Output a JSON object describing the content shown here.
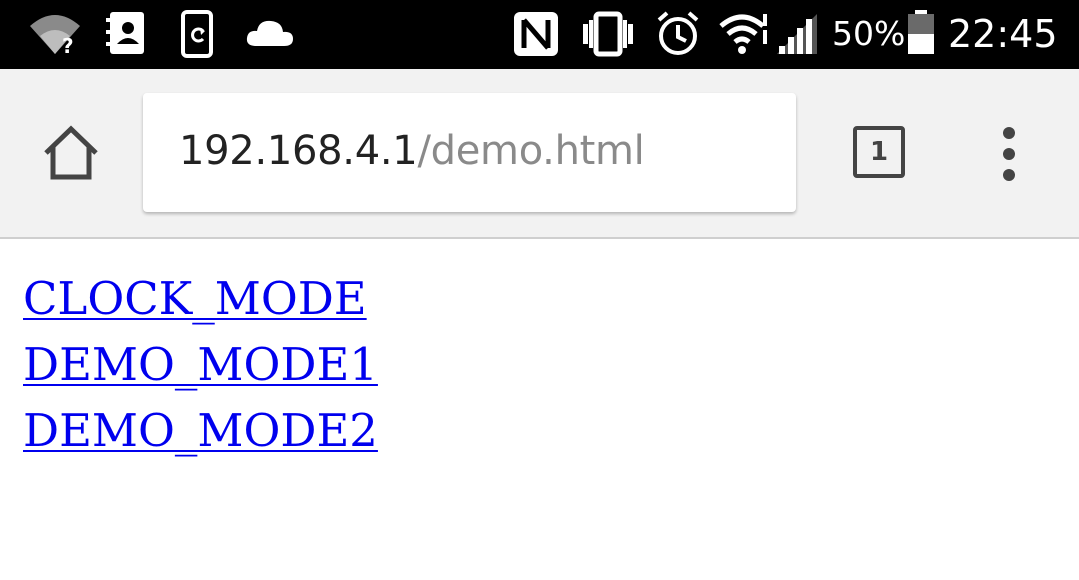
{
  "status_bar": {
    "battery_percent": "50%",
    "time": "22:45",
    "icons": [
      "wifi-question-icon",
      "contacts-icon",
      "phone-sync-icon",
      "cloud-icon",
      "nfc-icon",
      "vibrate-icon",
      "alarm-icon",
      "wifi-icon",
      "cell-signal-icon",
      "battery-icon"
    ]
  },
  "browser": {
    "url_host": "192.168.4.1",
    "url_path": "/demo.html",
    "tab_count": "1"
  },
  "page": {
    "links": [
      {
        "label": "CLOCK_MODE"
      },
      {
        "label": "DEMO_MODE1"
      },
      {
        "label": "DEMO_MODE2"
      }
    ]
  },
  "colors": {
    "status_bar_bg": "#000000",
    "toolbar_bg": "#f2f2f2",
    "link": "#0000ee"
  }
}
